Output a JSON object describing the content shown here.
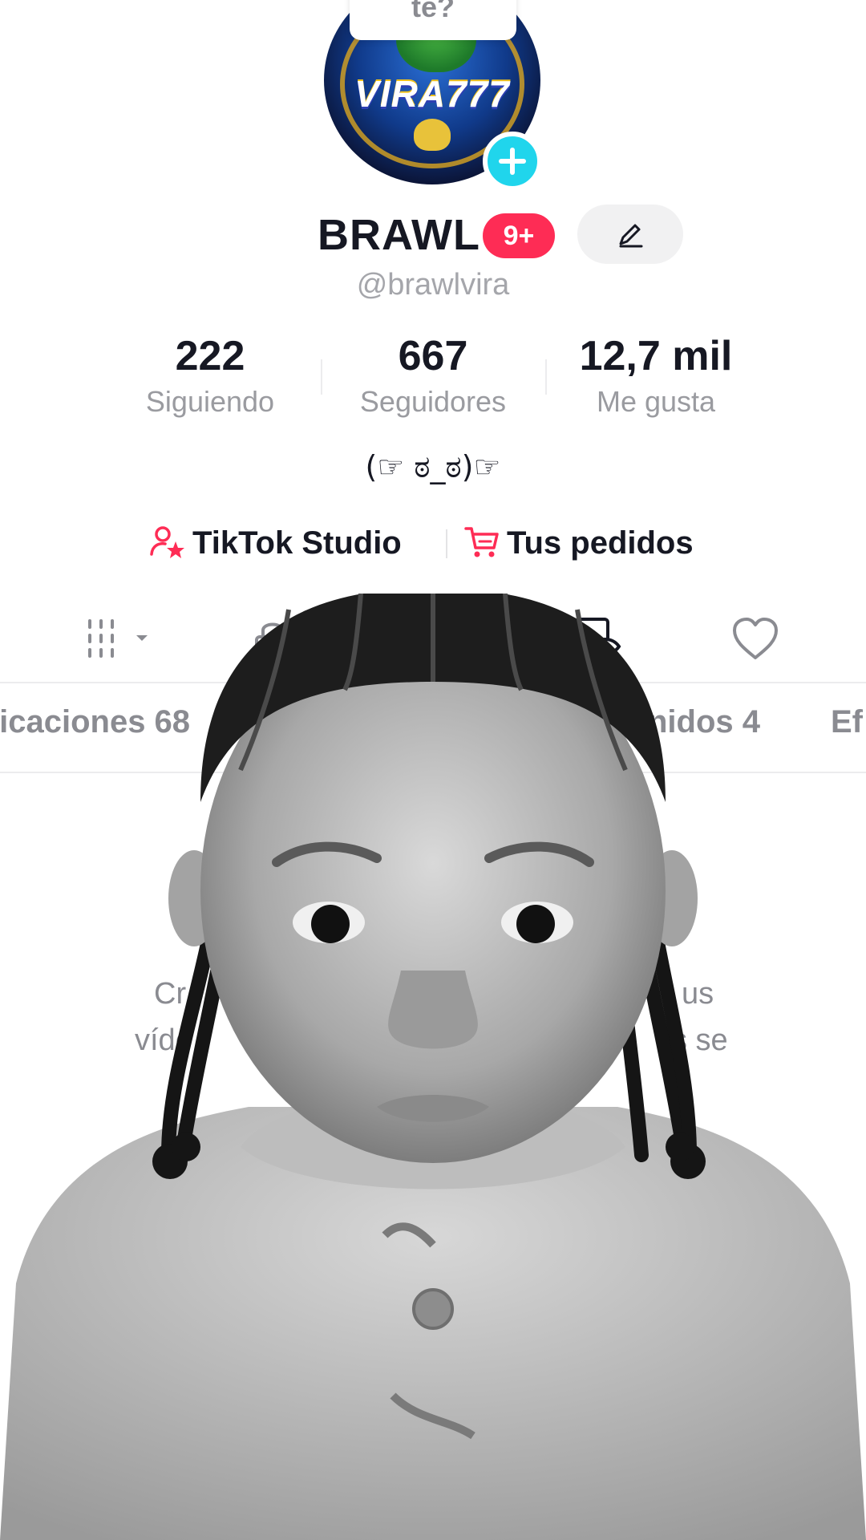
{
  "bubble": {
    "text": "te?"
  },
  "profile": {
    "name": "BRAWL",
    "notification_badge": "9+",
    "handle": "@brawlvira",
    "avatar_logo_text": "VIRA777",
    "bio": "(☞ ಠ_ಠ)☞"
  },
  "stats": [
    {
      "value": "222",
      "label": "Siguiendo"
    },
    {
      "value": "667",
      "label": "Seguidores"
    },
    {
      "value": "12,7 mil",
      "label": "Me gusta"
    }
  ],
  "links": {
    "studio": "TikTok Studio",
    "orders": "Tus pedidos"
  },
  "icon_tabs": [
    "grid-icon",
    "lock-icon",
    "repost-icon",
    "hidden-icon",
    "heart-icon"
  ],
  "sub_tabs": {
    "publications": "licaciones 68",
    "content": "nidos 4",
    "effects": "Ef"
  },
  "empty_state": {
    "line1_left": "Cr",
    "line1_right": "us",
    "line2_left": "víde",
    "line2_right": "s se"
  },
  "colors": {
    "accent_red": "#fe2c55",
    "accent_cyan": "#20d5ec",
    "text_primary": "#161823",
    "text_secondary": "#8a8b91"
  }
}
